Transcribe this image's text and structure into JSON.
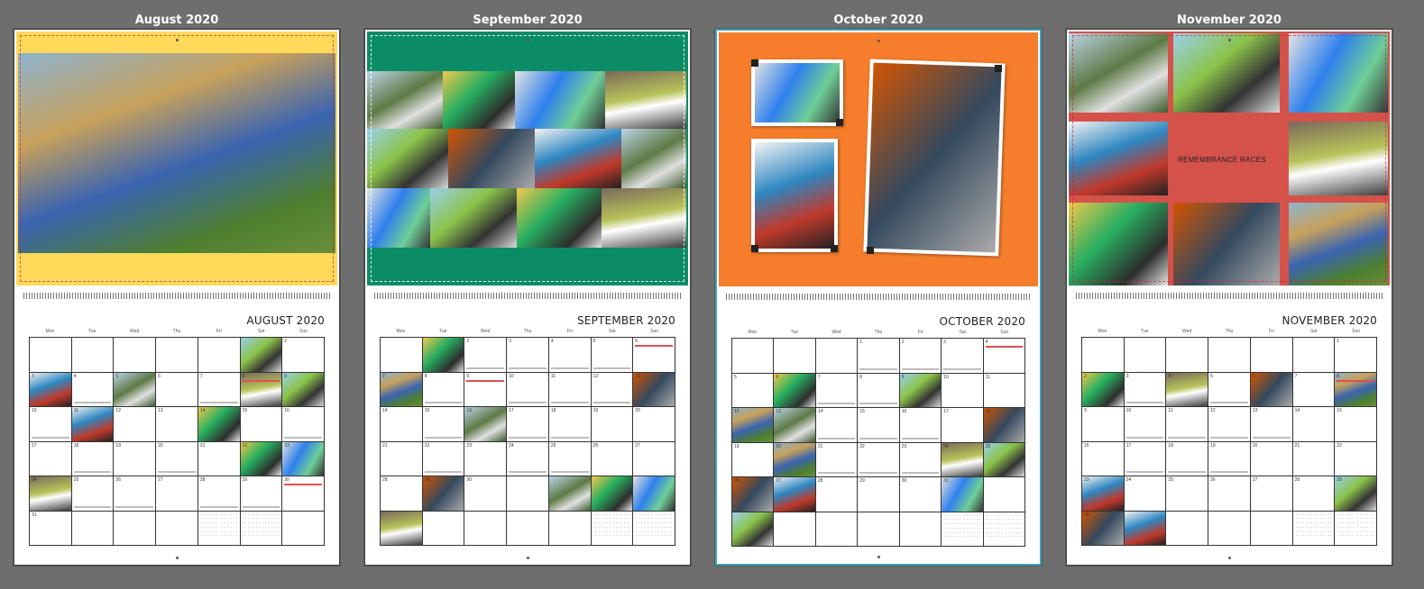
{
  "pages": [
    {
      "id": "aug",
      "title": "August 2020",
      "heading": "AUGUST 2020",
      "weekdays": [
        "Mon",
        "Tue",
        "Wed",
        "Thu",
        "Fri",
        "Sat",
        "Sun"
      ],
      "cells": [
        "",
        "",
        "",
        "",
        "",
        "",
        "2",
        "3",
        "4",
        "5",
        "6",
        "7",
        "8",
        "9",
        "10",
        "11",
        "12",
        "13",
        "14",
        "15",
        "16",
        "17",
        "18",
        "19",
        "20",
        "21",
        "22",
        "23",
        "24",
        "25",
        "26",
        "27",
        "28",
        "29",
        "30",
        "31",
        "",
        "",
        "",
        "",
        "",
        ""
      ]
    },
    {
      "id": "sep",
      "title": "September 2020",
      "heading": "SEPTEMBER 2020",
      "weekdays": [
        "Mon",
        "Tue",
        "Wed",
        "Thu",
        "Fri",
        "Sat",
        "Sun"
      ],
      "cells": [
        "",
        "",
        "2",
        "3",
        "4",
        "5",
        "6",
        "7",
        "8",
        "9",
        "10",
        "11",
        "12",
        "13",
        "14",
        "15",
        "16",
        "17",
        "18",
        "19",
        "20",
        "21",
        "22",
        "23",
        "24",
        "25",
        "26",
        "27",
        "28",
        "29",
        "30",
        "",
        "",
        "",
        "",
        "",
        "",
        "",
        "",
        "",
        "",
        ""
      ]
    },
    {
      "id": "oct",
      "title": "October 2020",
      "heading": "OCTOBER 2020",
      "weekdays": [
        "Mon",
        "Tue",
        "Wed",
        "Thu",
        "Fri",
        "Sat",
        "Sun"
      ],
      "cells": [
        "",
        "",
        "",
        "1",
        "2",
        "3",
        "4",
        "5",
        "6",
        "7",
        "8",
        "9",
        "10",
        "11",
        "12",
        "13",
        "14",
        "15",
        "16",
        "17",
        "18",
        "19",
        "20",
        "21",
        "22",
        "23",
        "24",
        "25",
        "26",
        "27",
        "28",
        "29",
        "30",
        "31",
        "",
        "",
        "",
        "",
        "",
        "",
        "",
        ""
      ]
    },
    {
      "id": "nov",
      "title": "November 2020",
      "heading": "NOVEMBER 2020",
      "weekdays": [
        "Mon",
        "Tue",
        "Wed",
        "Thu",
        "Fri",
        "Sat",
        "Sun"
      ],
      "cells": [
        "",
        "",
        "",
        "",
        "",
        "",
        "1",
        "2",
        "3",
        "4",
        "5",
        "6",
        "7",
        "8",
        "9",
        "10",
        "11",
        "12",
        "13",
        "14",
        "15",
        "16",
        "17",
        "18",
        "19",
        "20",
        "21",
        "22",
        "23",
        "24",
        "25",
        "26",
        "27",
        "28",
        "29",
        "30",
        "",
        "",
        "",
        "",
        "",
        ""
      ],
      "banner": "REMEMBRANCE RACES"
    }
  ],
  "colors": {
    "aug_band": "#ffd95a",
    "sep_band": "#0c8c66",
    "oct_band": "#f57d2c",
    "nov_band": "#d4524a",
    "selection": "#3aa6b9"
  }
}
